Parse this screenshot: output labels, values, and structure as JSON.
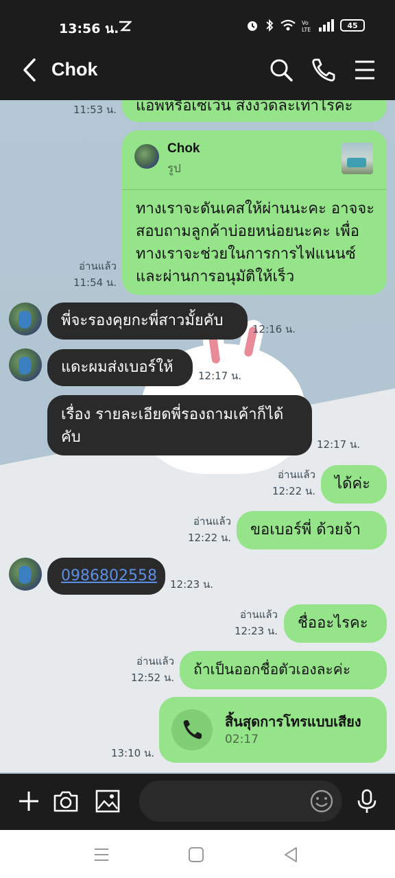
{
  "status": {
    "time": "13:56 น.",
    "battery": "45"
  },
  "header": {
    "title": "Chok"
  },
  "messages": {
    "m0": {
      "text": "แอพหรือเซเว่น ส่งงวดละเท่าไรคะ",
      "time": "11:53 น."
    },
    "m1": {
      "reply_name": "Chok",
      "reply_sub": "รูป",
      "text": "ทางเราจะดันเคสให้ผ่านนะคะ อาจจะสอบถามลูกค้าบ่อยหน่อยนะคะ เพื่อทางเราจะช่วยในการการไฟแนนซ์และผ่านการอนุมัติให้เร็ว",
      "read": "อ่านแล้ว",
      "time": "11:54 น."
    },
    "m2": {
      "text": "พี่จะรองคุยกะพี่สาวมั้ยคับ",
      "time": "12:16 น."
    },
    "m3": {
      "text": "แดะผมส่งเบอร์ให้",
      "time": "12:17 น."
    },
    "m4": {
      "text": "เรื่อง รายละเอียดพี่รองถามเค้าก็ได้คับ",
      "time": "12:17 น."
    },
    "m5": {
      "text": "ได้ค่ะ",
      "read": "อ่านแล้ว",
      "time": "12:22 น."
    },
    "m6": {
      "text": "ขอเบอร์พี่ ด้วยจ้า",
      "read": "อ่านแล้ว",
      "time": "12:22 น."
    },
    "m7": {
      "text": "0986802558",
      "time": "12:23 น."
    },
    "m8": {
      "text": "ชื่ออะไรคะ",
      "read": "อ่านแล้ว",
      "time": "12:23 น."
    },
    "m9": {
      "text": "ถ้าเป็นออกชื่อตัวเองละค่ะ",
      "read": "อ่านแล้ว",
      "time": "12:52 น."
    },
    "m10": {
      "title": "สิ้นสุดการโทรแบบเสียง",
      "duration": "02:17",
      "time": "13:10 น."
    }
  },
  "colors": {
    "sent_bubble": "#95e48a",
    "received_bubble": "#2a2a2a",
    "header_bg": "#1c1c1c",
    "chat_bg": "#b4c7d4",
    "link": "#5b8ee6"
  },
  "icons": {
    "header": [
      "back-arrow-icon",
      "search-icon",
      "phone-icon",
      "menu-icon"
    ],
    "input": [
      "plus-icon",
      "camera-icon",
      "image-icon",
      "emoji-icon",
      "mic-icon"
    ],
    "nav": [
      "recents-icon",
      "home-icon",
      "back-icon"
    ]
  }
}
